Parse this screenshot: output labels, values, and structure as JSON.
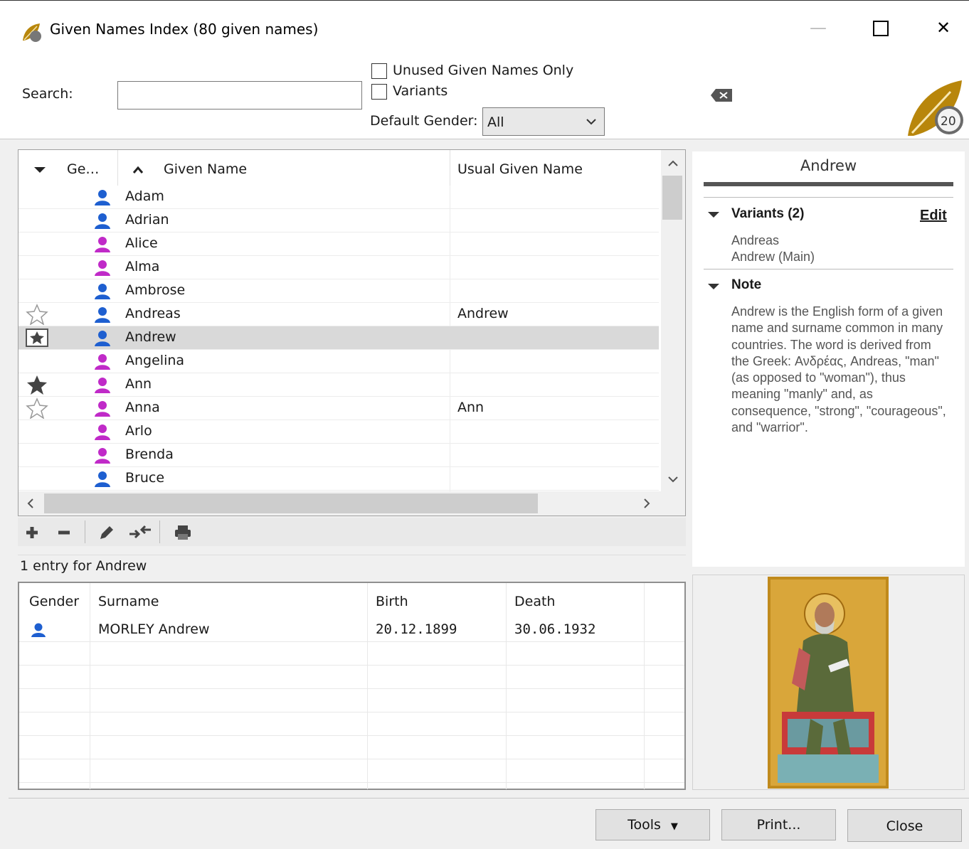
{
  "window": {
    "title": "Given Names Index (80 given names)",
    "minimize": "—",
    "maximize": "☐",
    "close": "✕"
  },
  "search": {
    "label": "Search:",
    "value": "",
    "placeholder": ""
  },
  "filters": {
    "unused_only_label": "Unused Given Names Only",
    "variants_label": "Variants",
    "default_gender_label": "Default Gender:",
    "default_gender_value": "All",
    "clear_icon": "backspace-clear-icon"
  },
  "brand": {
    "logo_text": "20"
  },
  "names_table": {
    "columns": {
      "gender": "Ge…",
      "given_name": "Given Name",
      "usual_given_name": "Usual Given Name"
    },
    "rows": [
      {
        "star": "",
        "gender": "male",
        "name": "Adam",
        "usual": ""
      },
      {
        "star": "",
        "gender": "male",
        "name": "Adrian",
        "usual": ""
      },
      {
        "star": "",
        "gender": "female",
        "name": "Alice",
        "usual": ""
      },
      {
        "star": "",
        "gender": "female",
        "name": "Alma",
        "usual": ""
      },
      {
        "star": "",
        "gender": "male",
        "name": "Ambrose",
        "usual": ""
      },
      {
        "star": "outline",
        "gender": "male",
        "name": "Andreas",
        "usual": "Andrew"
      },
      {
        "star": "boxed",
        "gender": "male",
        "name": "Andrew",
        "usual": "",
        "selected": true
      },
      {
        "star": "",
        "gender": "female",
        "name": "Angelina",
        "usual": ""
      },
      {
        "star": "filled",
        "gender": "female",
        "name": "Ann",
        "usual": ""
      },
      {
        "star": "outline",
        "gender": "female",
        "name": "Anna",
        "usual": "Ann"
      },
      {
        "star": "",
        "gender": "female",
        "name": "Arlo",
        "usual": ""
      },
      {
        "star": "",
        "gender": "female",
        "name": "Brenda",
        "usual": ""
      },
      {
        "star": "",
        "gender": "male",
        "name": "Bruce",
        "usual": ""
      }
    ]
  },
  "toolbar": {
    "add": "plus-icon",
    "remove": "minus-icon",
    "edit": "pencil-icon",
    "merge": "merge-arrows-icon",
    "print": "printer-icon"
  },
  "entries": {
    "summary": "1 entry for Andrew",
    "columns": {
      "gender": "Gender",
      "surname": "Surname",
      "birth": "Birth",
      "death": "Death"
    },
    "rows": [
      {
        "gender": "male",
        "surname": "MORLEY Andrew",
        "birth": "20.12.1899",
        "death": "30.06.1932"
      }
    ]
  },
  "detail": {
    "name": "Andrew",
    "variants_heading": "Variants (2)",
    "edit_link": "Edit",
    "variants": [
      "Andreas",
      "Andrew (Main)"
    ],
    "note_heading": "Note",
    "note_text": "Andrew is the English form of a given name and surname common in many countries. The word is derived from the Greek: Ανδρέας, Andreas, \"man\" (as opposed to \"woman\"), thus meaning \"manly\" and, as consequence, \"strong\", \"courageous\", and \"warrior\"."
  },
  "buttons": {
    "tools": "Tools",
    "print": "Print...",
    "close": "Close"
  },
  "colors": {
    "male": "#1e5fd0",
    "female": "#c02ac8",
    "selected_row": "#d9d9d9"
  }
}
